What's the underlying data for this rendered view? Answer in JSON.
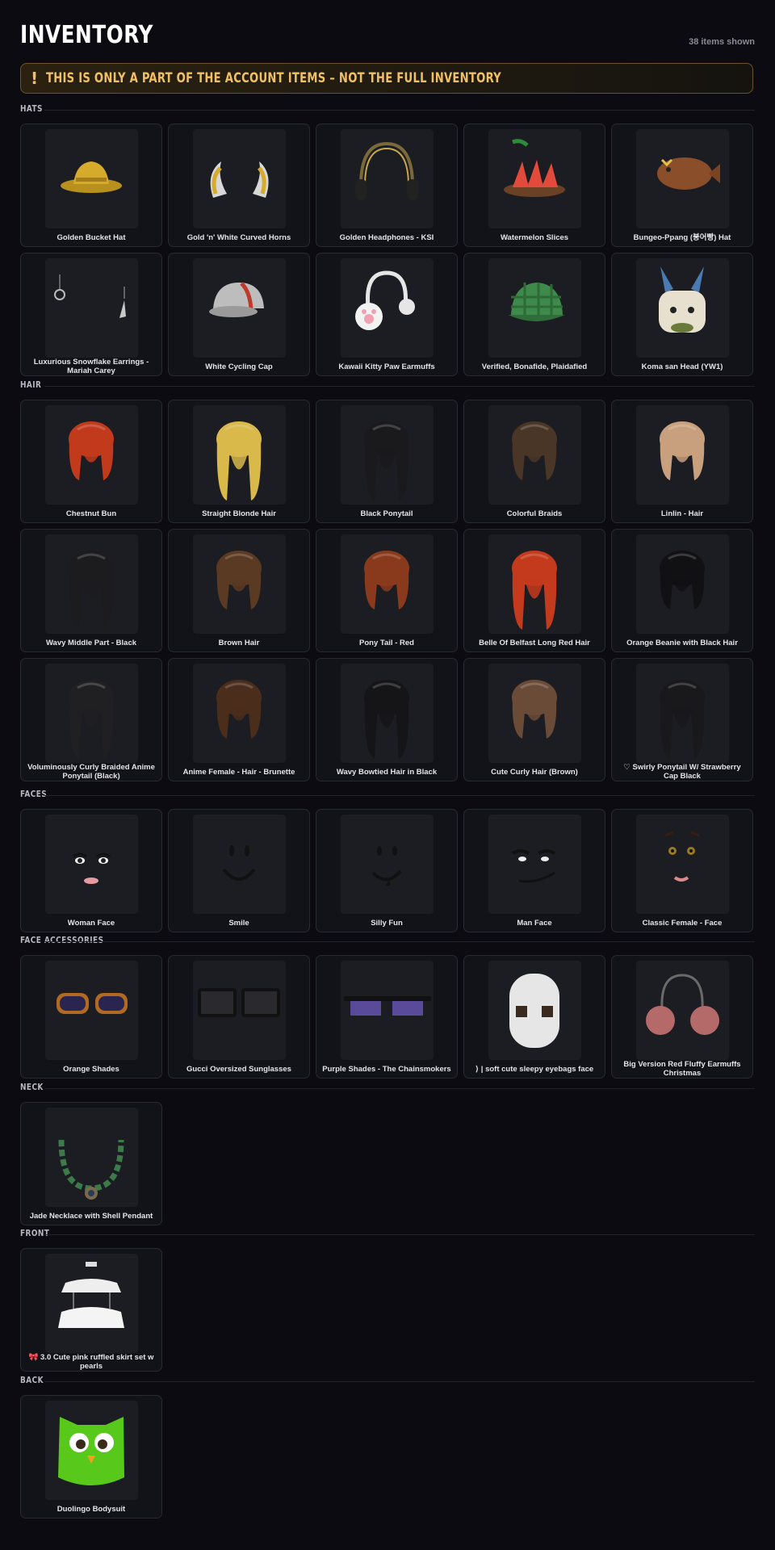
{
  "header": {
    "title": "INVENTORY",
    "count": "38 items shown"
  },
  "banner": {
    "icon": "!",
    "text": "THIS IS ONLY A PART OF THE ACCOUNT ITEMS – NOT THE FULL INVENTORY",
    "accent": "#f2c064"
  },
  "sections": {
    "hats": {
      "label": "HATS",
      "items": [
        {
          "name": "Golden Bucket Hat",
          "icon": "bucket-hat-icon"
        },
        {
          "name": "Gold 'n' White Curved Horns",
          "icon": "horns-icon"
        },
        {
          "name": "Golden Headphones - KSI",
          "icon": "headphones-icon"
        },
        {
          "name": "Watermelon Slices",
          "icon": "watermelon-icon"
        },
        {
          "name": "Bungeo-Ppang (붕어빵) Hat",
          "icon": "fish-bread-icon"
        },
        {
          "name": "Luxurious Snowflake Earrings - Mariah Carey",
          "icon": "earrings-icon"
        },
        {
          "name": "White Cycling Cap",
          "icon": "cycling-cap-icon"
        },
        {
          "name": "Kawaii Kitty Paw Earmuffs",
          "icon": "paw-earmuffs-icon"
        },
        {
          "name": "Verified, Bonafide, Plaidafied",
          "icon": "plaid-cap-icon"
        },
        {
          "name": "Koma san Head (YW1)",
          "icon": "koma-head-icon"
        }
      ]
    },
    "hair": {
      "label": "HAIR",
      "items": [
        {
          "name": "Chestnut Bun",
          "icon": "hair-icon"
        },
        {
          "name": "Straight Blonde Hair",
          "icon": "hair-icon"
        },
        {
          "name": "Black Ponytail",
          "icon": "hair-icon"
        },
        {
          "name": "Colorful Braids",
          "icon": "hair-icon"
        },
        {
          "name": "Linlin - Hair",
          "icon": "hair-icon"
        },
        {
          "name": "Wavy Middle Part - Black",
          "icon": "hair-icon"
        },
        {
          "name": "Brown Hair",
          "icon": "hair-icon"
        },
        {
          "name": "Pony Tail - Red",
          "icon": "hair-icon"
        },
        {
          "name": "Belle Of Belfast Long Red Hair",
          "icon": "hair-icon"
        },
        {
          "name": "Orange Beanie with Black Hair",
          "icon": "hair-icon"
        },
        {
          "name": "Voluminously Curly Braided Anime Ponytail (Black)",
          "icon": "hair-icon"
        },
        {
          "name": "Anime Female - Hair - Brunette",
          "icon": "hair-icon"
        },
        {
          "name": "Wavy Bowtied Hair in Black",
          "icon": "hair-icon"
        },
        {
          "name": "Cute Curly Hair (Brown)",
          "icon": "hair-icon"
        },
        {
          "name": "♡ Swirly Ponytail W/ Strawberry Cap Black",
          "icon": "hair-icon"
        }
      ]
    },
    "faces": {
      "label": "FACES",
      "items": [
        {
          "name": "Woman Face",
          "icon": "face-icon"
        },
        {
          "name": "Smile",
          "icon": "face-icon"
        },
        {
          "name": "Silly Fun",
          "icon": "face-icon"
        },
        {
          "name": "Man Face",
          "icon": "face-icon"
        },
        {
          "name": "Classic Female - Face",
          "icon": "face-icon"
        }
      ]
    },
    "face_accessories": {
      "label": "FACE ACCESSORIES",
      "items": [
        {
          "name": "Orange Shades",
          "icon": "sunglasses-icon"
        },
        {
          "name": "Gucci Oversized Sunglasses",
          "icon": "sunglasses-icon"
        },
        {
          "name": "Purple Shades - The Chainsmokers",
          "icon": "sunglasses-icon"
        },
        {
          "name": "⟩ | soft cute sleepy eyebags face",
          "icon": "mask-face-icon"
        },
        {
          "name": "Big Version Red Fluffy Earmuffs Christmas",
          "icon": "earmuffs-icon"
        }
      ]
    },
    "neck": {
      "label": "NECK",
      "items": [
        {
          "name": "Jade Necklace with Shell Pendant",
          "icon": "necklace-icon"
        }
      ]
    },
    "front": {
      "label": "FRONT",
      "items": [
        {
          "name": "🎀 3.0 Cute pink ruffled skirt set w pearls",
          "icon": "skirt-icon"
        }
      ]
    },
    "back": {
      "label": "BACK",
      "items": [
        {
          "name": "Duolingo Bodysuit",
          "icon": "owl-icon"
        }
      ]
    }
  }
}
